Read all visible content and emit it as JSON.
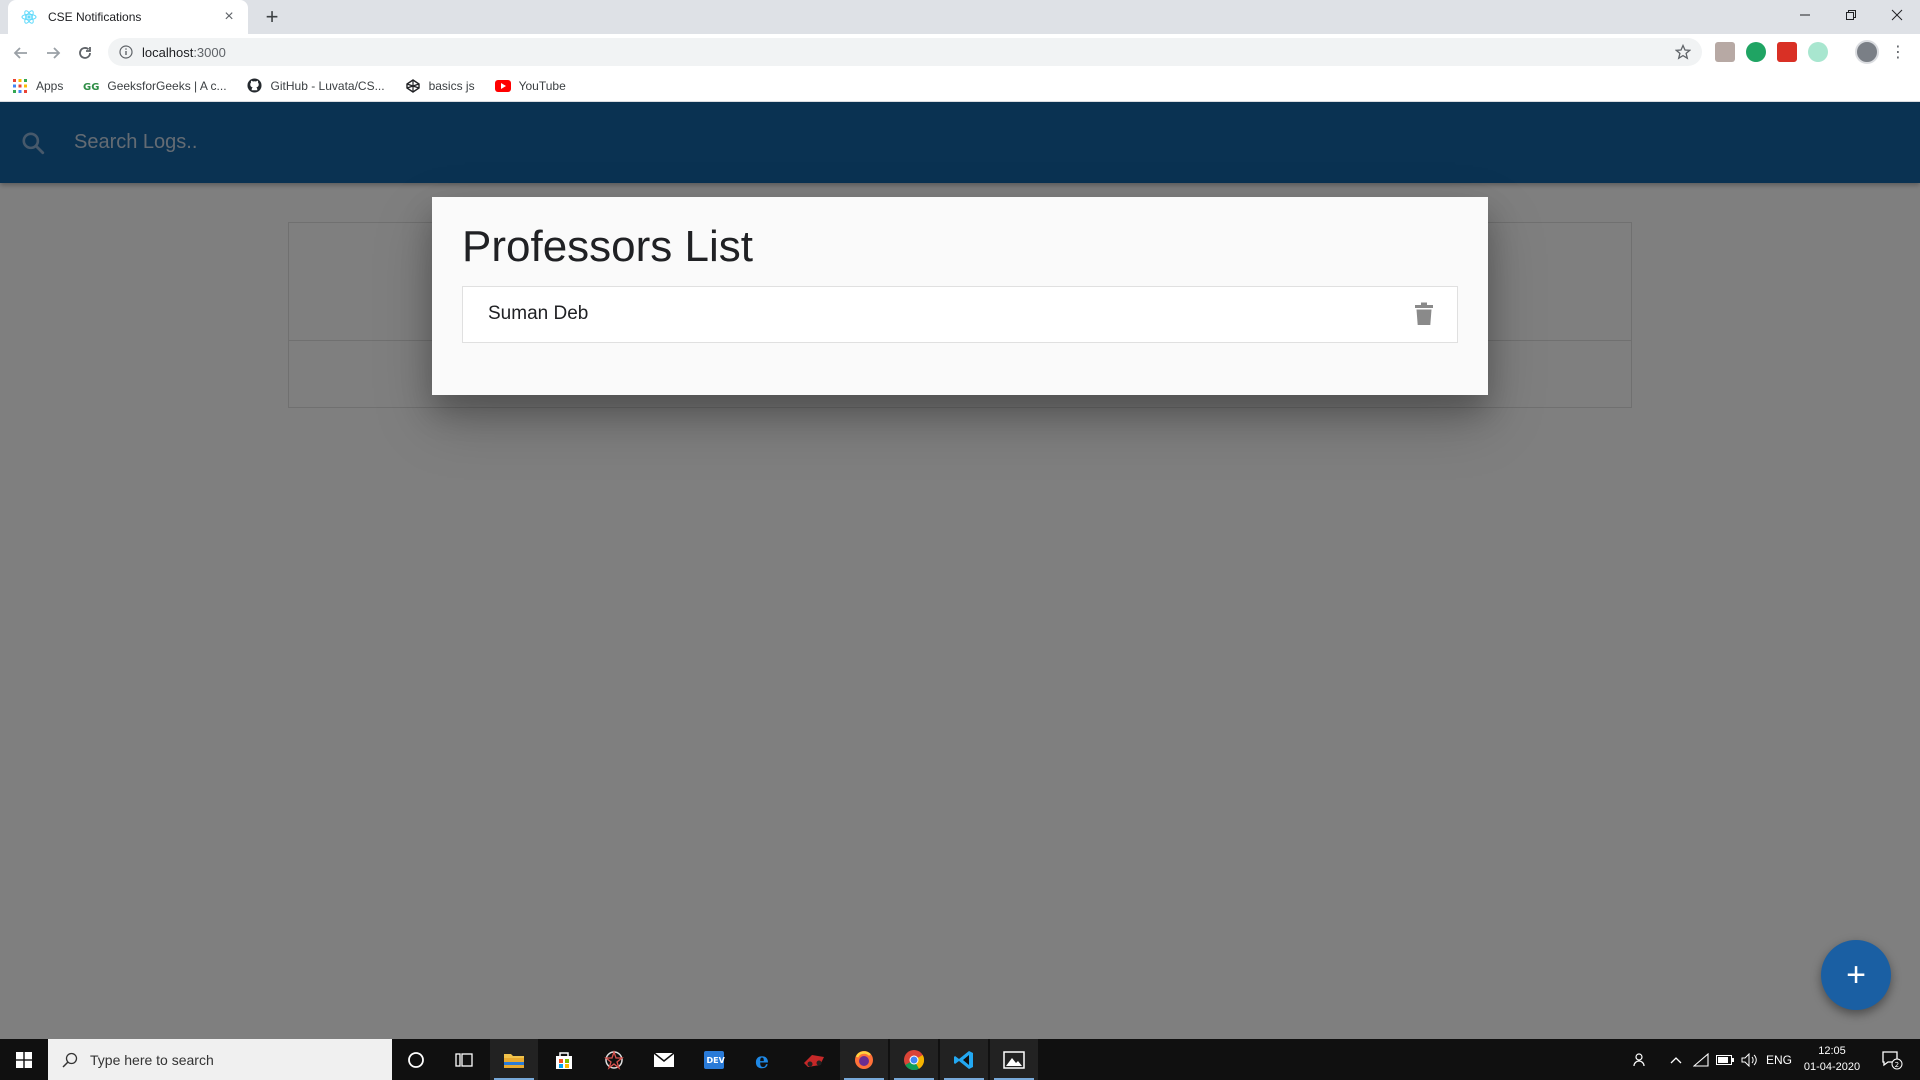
{
  "browser": {
    "tab_title": "CSE Notifications",
    "tab_close": "×",
    "new_tab": "+",
    "url_host": "localhost",
    "url_port": ":3000",
    "bookmarks": [
      {
        "label": "Apps",
        "icon": "apps-grid-icon"
      },
      {
        "label": "GeeksforGeeks | A c...",
        "icon": "geeksforgeeks-icon"
      },
      {
        "label": "GitHub - Luvata/CS...",
        "icon": "github-icon"
      },
      {
        "label": "basics js",
        "icon": "codepen-icon"
      },
      {
        "label": "YouTube",
        "icon": "youtube-icon"
      }
    ]
  },
  "app": {
    "search_placeholder": "Search Logs..",
    "accent_color": "#1565a5",
    "fab_label": "+"
  },
  "modal": {
    "title": "Professors List",
    "professors": [
      {
        "name": "Suman Deb"
      }
    ]
  },
  "taskbar": {
    "search_placeholder": "Type here to search",
    "language": "ENG",
    "time": "12:05",
    "date": "01-04-2020",
    "notification_count": "2"
  }
}
